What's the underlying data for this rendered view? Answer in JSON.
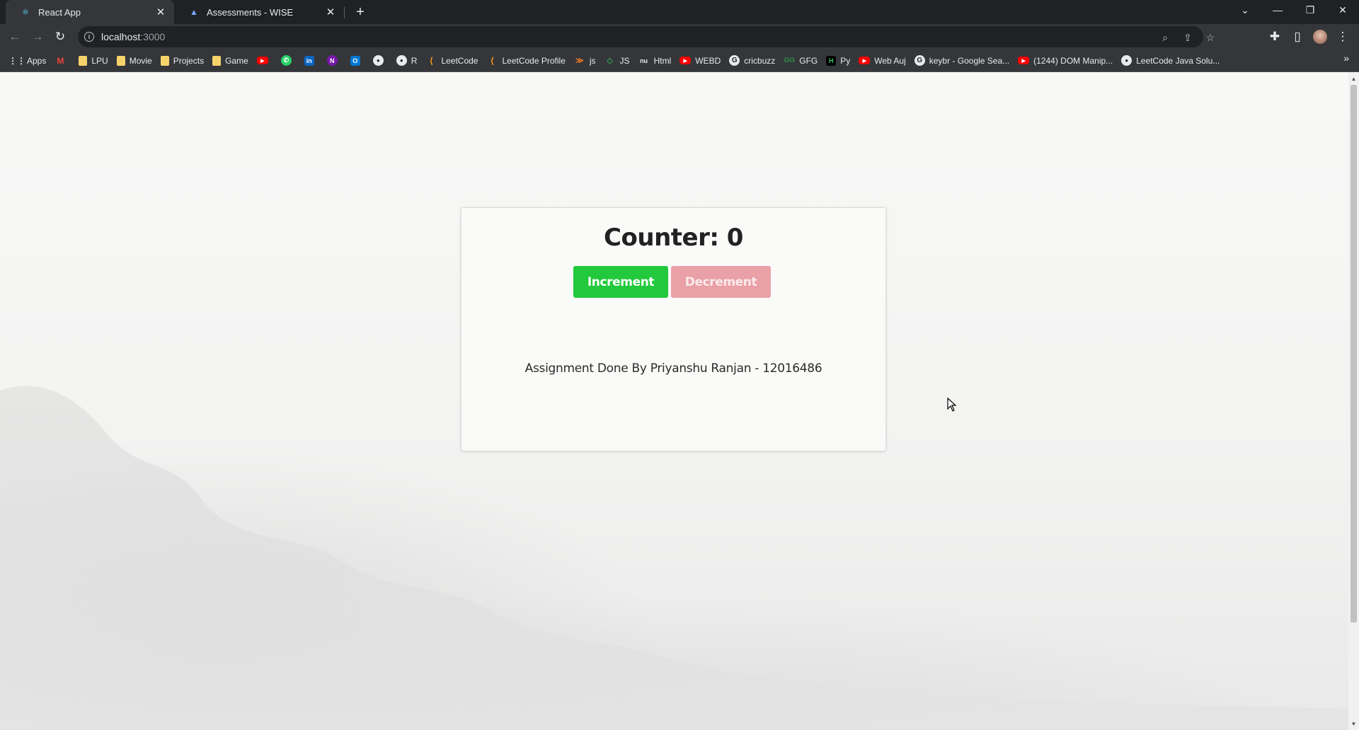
{
  "browser": {
    "tabs": [
      {
        "title": "React App",
        "active": true,
        "icon": "react-icon"
      },
      {
        "title": "Assessments - WISE",
        "active": false,
        "icon": "wise-icon"
      }
    ],
    "url": {
      "host": "localhost",
      "port": ":3000"
    },
    "bookmarks": [
      {
        "label": "Apps",
        "icon": "apps-grid-icon"
      },
      {
        "label": "",
        "icon": "gmail-icon"
      },
      {
        "label": "LPU",
        "icon": "folder-icon"
      },
      {
        "label": "Movie",
        "icon": "folder-icon"
      },
      {
        "label": "Projects",
        "icon": "folder-icon"
      },
      {
        "label": "Game",
        "icon": "folder-icon"
      },
      {
        "label": "",
        "icon": "youtube-icon"
      },
      {
        "label": "",
        "icon": "whatsapp-icon"
      },
      {
        "label": "",
        "icon": "linkedin-icon"
      },
      {
        "label": "",
        "icon": "onenote-icon"
      },
      {
        "label": "",
        "icon": "outlook-icon"
      },
      {
        "label": "",
        "icon": "github-icon"
      },
      {
        "label": "R",
        "icon": "github-icon"
      },
      {
        "label": "LeetCode",
        "icon": "leetcode-icon"
      },
      {
        "label": "LeetCode Profile",
        "icon": "leetcode-icon"
      },
      {
        "label": "js",
        "icon": "code-icon"
      },
      {
        "label": "JS",
        "icon": "code-icon"
      },
      {
        "label": "Html",
        "icon": "nu-icon"
      },
      {
        "label": "WEBD",
        "icon": "youtube-icon"
      },
      {
        "label": "cricbuzz",
        "icon": "google-icon"
      },
      {
        "label": "GFG",
        "icon": "gfg-icon"
      },
      {
        "label": "Py",
        "icon": "hackerrank-icon"
      },
      {
        "label": "Web Auj",
        "icon": "youtube-icon"
      },
      {
        "label": "keybr - Google Sea...",
        "icon": "google-icon"
      },
      {
        "label": "(1244) DOM Manip...",
        "icon": "youtube-icon"
      },
      {
        "label": "LeetCode Java Solu...",
        "icon": "github-icon"
      }
    ]
  },
  "app": {
    "heading": "Counter: 0",
    "increment_label": "Increment",
    "decrement_label": "Decrement",
    "credit": "Assignment Done By Priyanshu Ranjan - 12016486"
  },
  "colors": {
    "increment": "#22c93c",
    "decrement": "#e9a0a6"
  }
}
